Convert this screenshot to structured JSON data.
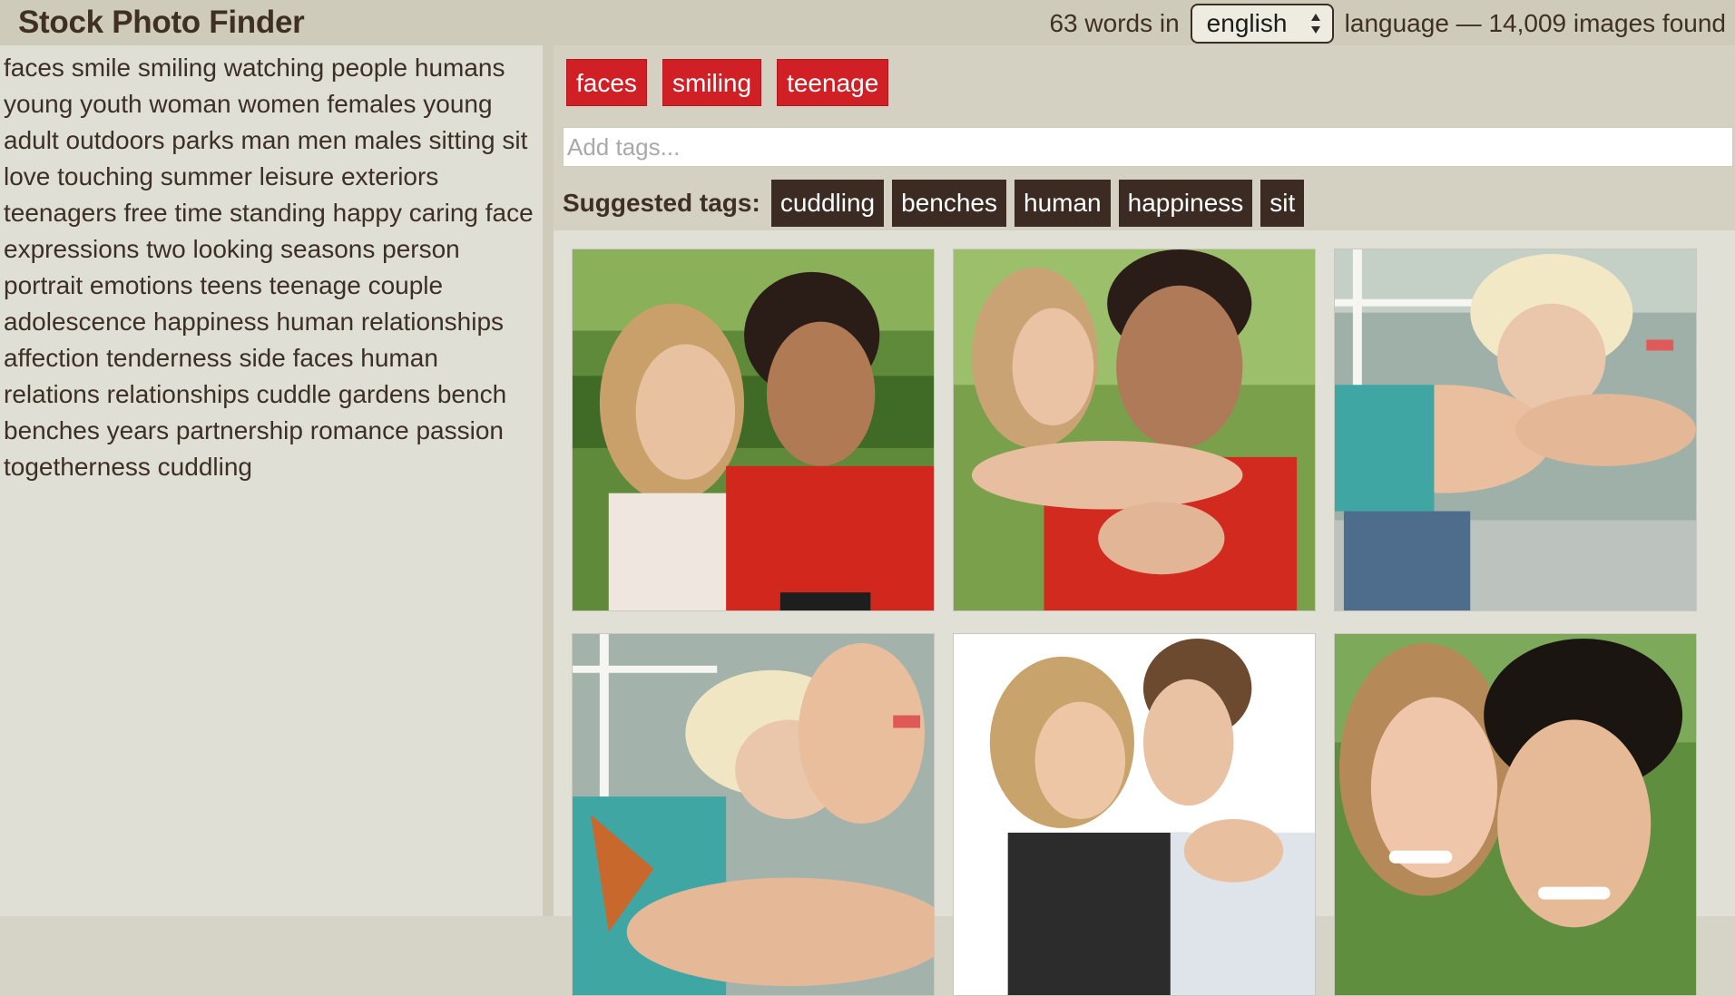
{
  "app": {
    "title": "Stock Photo Finder"
  },
  "header": {
    "word_count": "63 words in",
    "language_selected": "english",
    "language_suffix": "language — 14,009 images found"
  },
  "sidebar": {
    "words": "faces smile smiling watching people humans young youth woman women females young adult outdoors parks man men males sitting sit love touching summer leisure exteriors teenagers free time standing happy caring face expressions two looking seasons person portrait emotions teens teenage couple adolescence happiness human relationships affection tenderness side faces human relations relationships cuddle gardens bench benches years partnership romance passion togetherness cuddling"
  },
  "tags": {
    "selected": [
      "faces",
      "smiling",
      "teenage"
    ],
    "input_placeholder": "Add tags...",
    "suggested_label": "Suggested tags:",
    "suggested": [
      "cuddling",
      "benches",
      "human",
      "happiness",
      "sit"
    ]
  },
  "results": {
    "photos": [
      {
        "subject": "teen couple smiling, girl looking at boy in red shirt"
      },
      {
        "subject": "girl kissing boy on cheek while hugging him"
      },
      {
        "subject": "blonde teen girl leaning on arms, smiling"
      },
      {
        "subject": "blonde teen girl resting head on arm"
      },
      {
        "subject": "young couple face to face on white background"
      },
      {
        "subject": "smiling couple faces close together"
      }
    ]
  },
  "colors": {
    "selected_tag": "#d11f26",
    "suggested_tag": "#3c2b23",
    "header_bg": "#cfcbba",
    "sidebar_bg": "#e0dfd5"
  }
}
